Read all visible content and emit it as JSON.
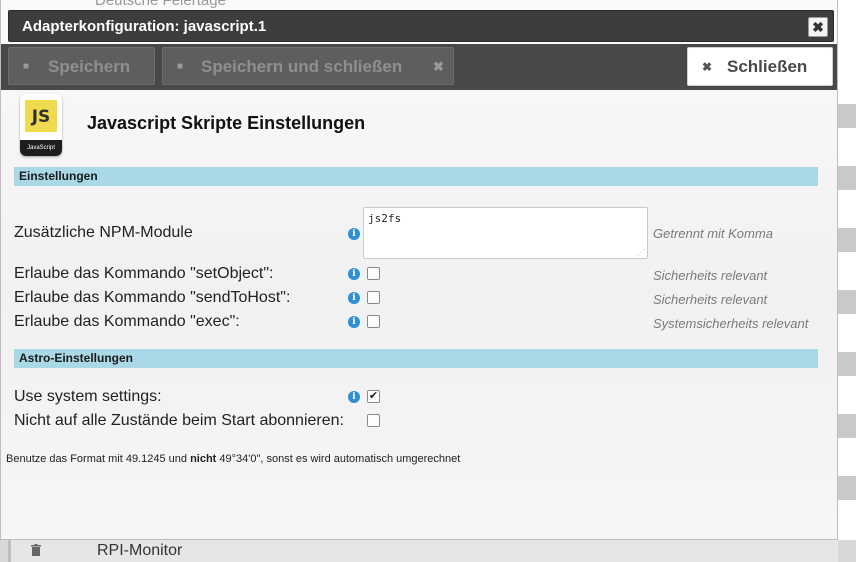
{
  "background": {
    "top_text": "Deutsche Feiertage",
    "row_text": "RPI-Monitor",
    "trash_icon": "trash-icon"
  },
  "dialog": {
    "title": "Adapterkonfiguration: javascript.1",
    "close_icon": "close-icon"
  },
  "toolbar": {
    "save_label": "Speichern",
    "save_close_label": "Speichern und schließen",
    "close_label": "Schließen",
    "save_icon": "floppy-icon"
  },
  "logo": {
    "text": "JS",
    "band": "JavaScript"
  },
  "heading": "Javascript Skripte Einstellungen",
  "sections": {
    "settings": "Einstellungen",
    "astro": "Astro-Einstellungen"
  },
  "fields": {
    "npm": {
      "label": "Zusätzliche NPM-Module",
      "value": "js2fs",
      "hint": "Getrennt mit Komma"
    },
    "set_object": {
      "label": "Erlaube das Kommando \"setObject\":",
      "checked": false,
      "hint": "Sicherheits relevant"
    },
    "send_to_host": {
      "label": "Erlaube das Kommando \"sendToHost\":",
      "checked": false,
      "hint": "Sicherheits relevant"
    },
    "exec": {
      "label": "Erlaube das Kommando \"exec\":",
      "checked": false,
      "hint": "Systemsicherheits relevant"
    },
    "use_system": {
      "label": "Use system settings:",
      "checked": true
    },
    "no_subscribe": {
      "label": "Nicht auf alle Zustände beim Start abonnieren:",
      "checked": false
    }
  },
  "note": {
    "part1": "Benutze das Format mit 49.1245 und ",
    "bold": "nicht",
    "part2": " 49°34'0\", sonst es wird automatisch umgerechnet"
  },
  "colors": {
    "section_bg": "#a9d8e6",
    "info_icon": "#2f8fd3",
    "toolbar_bg": "#484848"
  }
}
